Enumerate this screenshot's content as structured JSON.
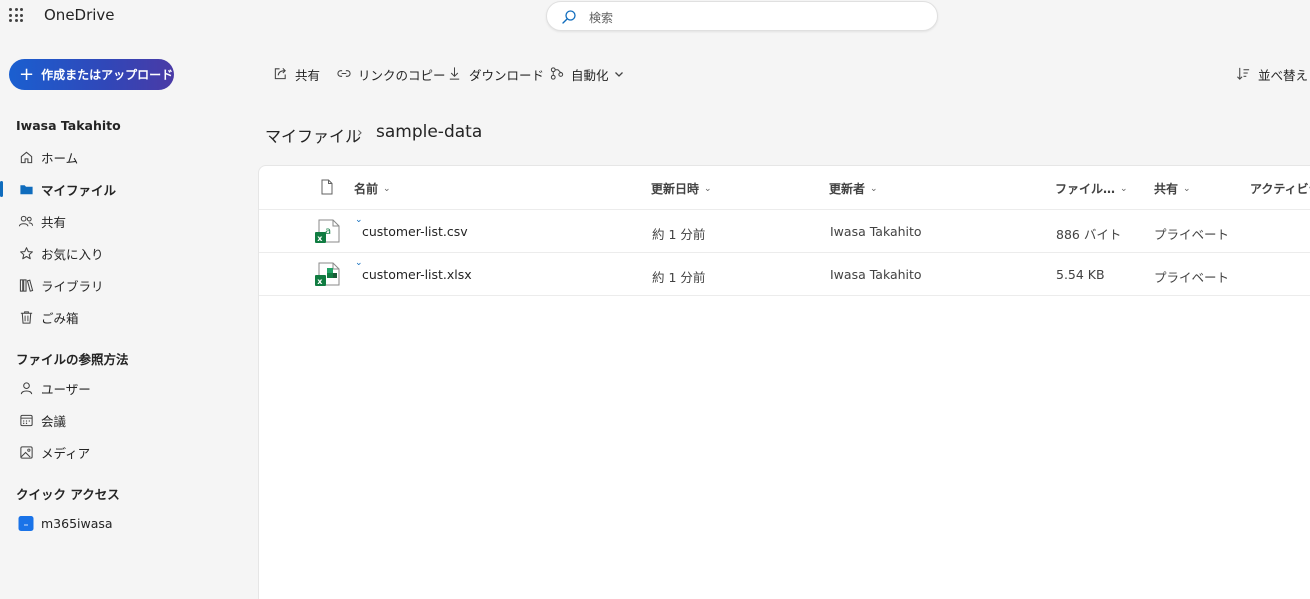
{
  "app": {
    "name": "OneDrive"
  },
  "search": {
    "placeholder": "検索"
  },
  "create_button": {
    "label": "作成またはアップロード"
  },
  "sidebar": {
    "user_name": "Iwasa Takahito",
    "items": [
      {
        "label": "ホーム",
        "icon": "home-icon"
      },
      {
        "label": "マイファイル",
        "icon": "folder-icon",
        "active": true
      },
      {
        "label": "共有",
        "icon": "people-icon"
      },
      {
        "label": "お気に入り",
        "icon": "star-icon"
      },
      {
        "label": "ライブラリ",
        "icon": "library-icon"
      },
      {
        "label": "ごみ箱",
        "icon": "trash-icon"
      }
    ],
    "browse_heading": "ファイルの参照方法",
    "browse_items": [
      {
        "label": "ユーザー",
        "icon": "person-icon"
      },
      {
        "label": "会議",
        "icon": "calendar-icon"
      },
      {
        "label": "メディア",
        "icon": "image-icon"
      }
    ],
    "quick_heading": "クイック アクセス",
    "quick_items": [
      {
        "label": "m365iwasa",
        "icon": "site-icon"
      }
    ]
  },
  "toolbar": {
    "share": "共有",
    "copy_link": "リンクのコピー",
    "download": "ダウンロード",
    "automate": "自動化",
    "sort": "並べ替え"
  },
  "breadcrumb": {
    "parent": "マイファイル",
    "separator": "›",
    "current": "sample-data"
  },
  "table": {
    "columns": {
      "name": "名前",
      "modified": "更新日時",
      "modified_by": "更新者",
      "file_size": "ファイル…",
      "sharing": "共有",
      "activity": "アクティビテ"
    },
    "rows": [
      {
        "name": "customer-list.csv",
        "modified": "約 1 分前",
        "modified_by": "Iwasa Takahito",
        "size": "886 バイト",
        "sharing": "プライベート",
        "type": "csv"
      },
      {
        "name": "customer-list.xlsx",
        "modified": "約 1 分前",
        "modified_by": "Iwasa Takahito",
        "size": "5.54 KB",
        "sharing": "プライベート",
        "type": "xlsx"
      }
    ]
  },
  "colors": {
    "accent": "#0f6cbd",
    "excel_green": "#107c41",
    "create_gradient_start": "#1a5fd0",
    "create_gradient_end": "#4a3aa6"
  }
}
